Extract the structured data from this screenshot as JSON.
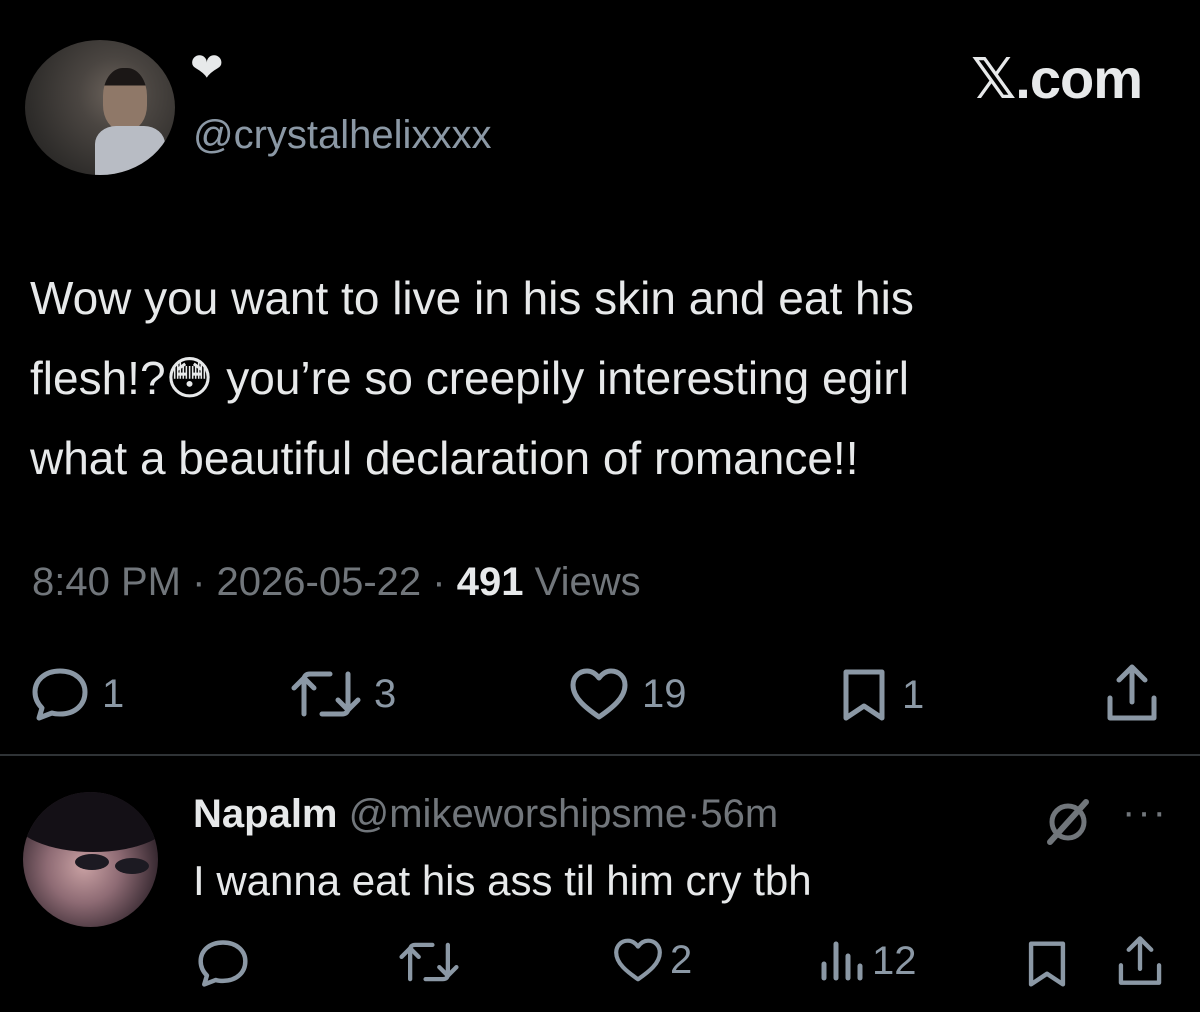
{
  "header": {
    "display_name_emoji": "❤",
    "handle": "@crystalhelixxxx",
    "brand": "𝕏.com"
  },
  "tweet": {
    "text": "Wow you want to live in his skin and eat his\nflesh!?😳 you’re so creepily interesting egirl\nwhat a beautiful declaration of romance!!",
    "time": "8:40 PM",
    "date": "2026-05-22",
    "separator": "·",
    "views_count": "491",
    "views_label": "Views",
    "actions": {
      "reply_count": "1",
      "repost_count": "3",
      "like_count": "19",
      "bookmark_count": "1"
    }
  },
  "reply": {
    "name": "Napalm",
    "handle": "@mikeworshipsme",
    "separator": "·",
    "age": "56m",
    "more": "···",
    "text": "I wanna eat his ass til him cry tbh",
    "actions": {
      "like_count": "2",
      "views_count": "12"
    }
  },
  "colors": {
    "background": "#000000",
    "text": "#e7e9ea",
    "muted": "#71767b",
    "icon": "#8b98a5",
    "divider": "#2f3336"
  },
  "icons": [
    "heart-icon",
    "reply-icon",
    "repost-icon",
    "like-icon",
    "bookmark-icon",
    "share-icon",
    "grok-icon",
    "views-icon",
    "more-icon"
  ]
}
